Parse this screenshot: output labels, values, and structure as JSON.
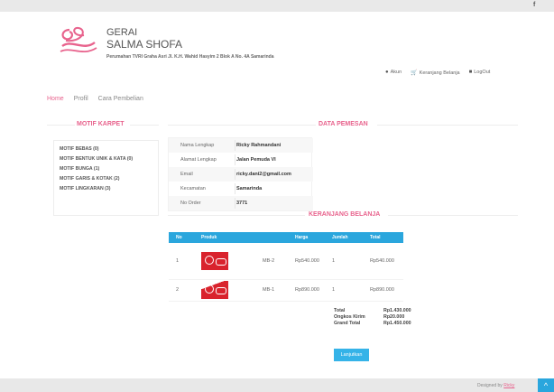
{
  "topbar": {
    "facebook_icon": "f"
  },
  "brand": {
    "line1": "GERAI",
    "line2": "SALMA SHOFA",
    "address": "Perumahan TVRI Graha Asri Jl. K.H. Wahid Hasyim 2 Blok A No. 4A Samarinda",
    "accent_color": "#e8638d"
  },
  "usernav": {
    "akun": "Akun",
    "keranjang": "Keranjang Belanja",
    "logout": "LogOut"
  },
  "mainnav": {
    "home": "Home",
    "profil": "Profil",
    "cara": "Cara Pembelian"
  },
  "sidebar": {
    "title": "MOTIF KARPET",
    "items": [
      {
        "label": "MOTIF BEBAS (0)"
      },
      {
        "label": "MOTIF BENTUK UNIK & KATA (0)"
      },
      {
        "label": "MOTIF BUNGA (1)"
      },
      {
        "label": "MOTIF GARIS & KOTAK (2)"
      },
      {
        "label": "MOTIF LINGKARAN (3)"
      }
    ]
  },
  "order": {
    "title": "DATA PEMESAN",
    "rows": [
      {
        "label": "Nama Lengkap",
        "value": "Ricky Rahmandani"
      },
      {
        "label": "Alamat Lengkap",
        "value": "Jalan Pemuda VI"
      },
      {
        "label": "Email",
        "value": "ricky.dani2@gmail.com"
      },
      {
        "label": "Kecamatan",
        "value": "Samarinda"
      },
      {
        "label": "No Order",
        "value": "3771"
      }
    ]
  },
  "cart": {
    "title": "KERANJANG BELANJA",
    "headers": {
      "no": "No",
      "produk": "Produk",
      "harga": "Harga",
      "jumlah": "Jumlah",
      "total": "Total"
    },
    "rows": [
      {
        "no": "1",
        "code": "MB-2",
        "harga": "Rp540.000",
        "jumlah": "1",
        "total": "Rp540.000"
      },
      {
        "no": "2",
        "code": "MB-1",
        "harga": "Rp890.000",
        "jumlah": "1",
        "total": "Rp890.000"
      }
    ],
    "summary": {
      "total_label": "Total",
      "total_value": "Rp1.430.000",
      "ongkos_label": "Ongkos Kirim",
      "ongkos_value": "Rp20.000",
      "grand_label": "Grand Total",
      "grand_value": "Rp1.450.000"
    },
    "button": "Lanjutkan"
  },
  "footer": {
    "designed": "Designed by",
    "author": "Ricky",
    "to_top_icon": "^"
  }
}
